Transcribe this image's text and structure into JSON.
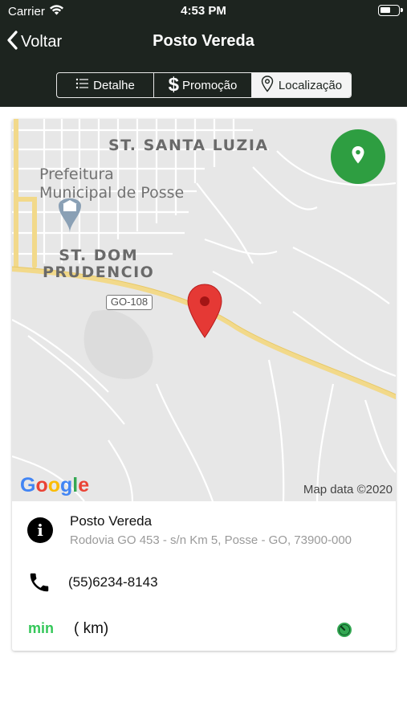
{
  "status_bar": {
    "carrier": "Carrier",
    "time": "4:53 PM"
  },
  "nav": {
    "back_label": "Voltar",
    "title": "Posto Vereda"
  },
  "segments": [
    {
      "label": "Detalhe",
      "icon": "list-icon",
      "selected": false
    },
    {
      "label": "Promoção",
      "icon": "dollar-icon",
      "selected": true
    },
    {
      "label": "Localização",
      "icon": "location-pin-icon",
      "selected": false
    }
  ],
  "map": {
    "labels": {
      "neighborhood_1": "ST. SANTA LUZIA",
      "landmark_line1": "Prefeitura",
      "landmark_line2": "Municipal de Posse",
      "neighborhood_2_line1": "ST. DOM",
      "neighborhood_2_line2": "PRUDENCIO",
      "road_shield": "GO-108"
    },
    "attribution": "Map data ©2020",
    "logo": "Google"
  },
  "station": {
    "name": "Posto Vereda",
    "address": "Rodovia GO 453 - s/n Km 5, Posse - GO, 73900-000",
    "phone": "(55)6234-8143",
    "duration_unit": "min",
    "distance_unit": "( km)"
  },
  "colors": {
    "header_bg": "#1d241f",
    "accent_green": "#2e9e41",
    "text_green": "#34c759",
    "pin_red": "#e53935"
  }
}
